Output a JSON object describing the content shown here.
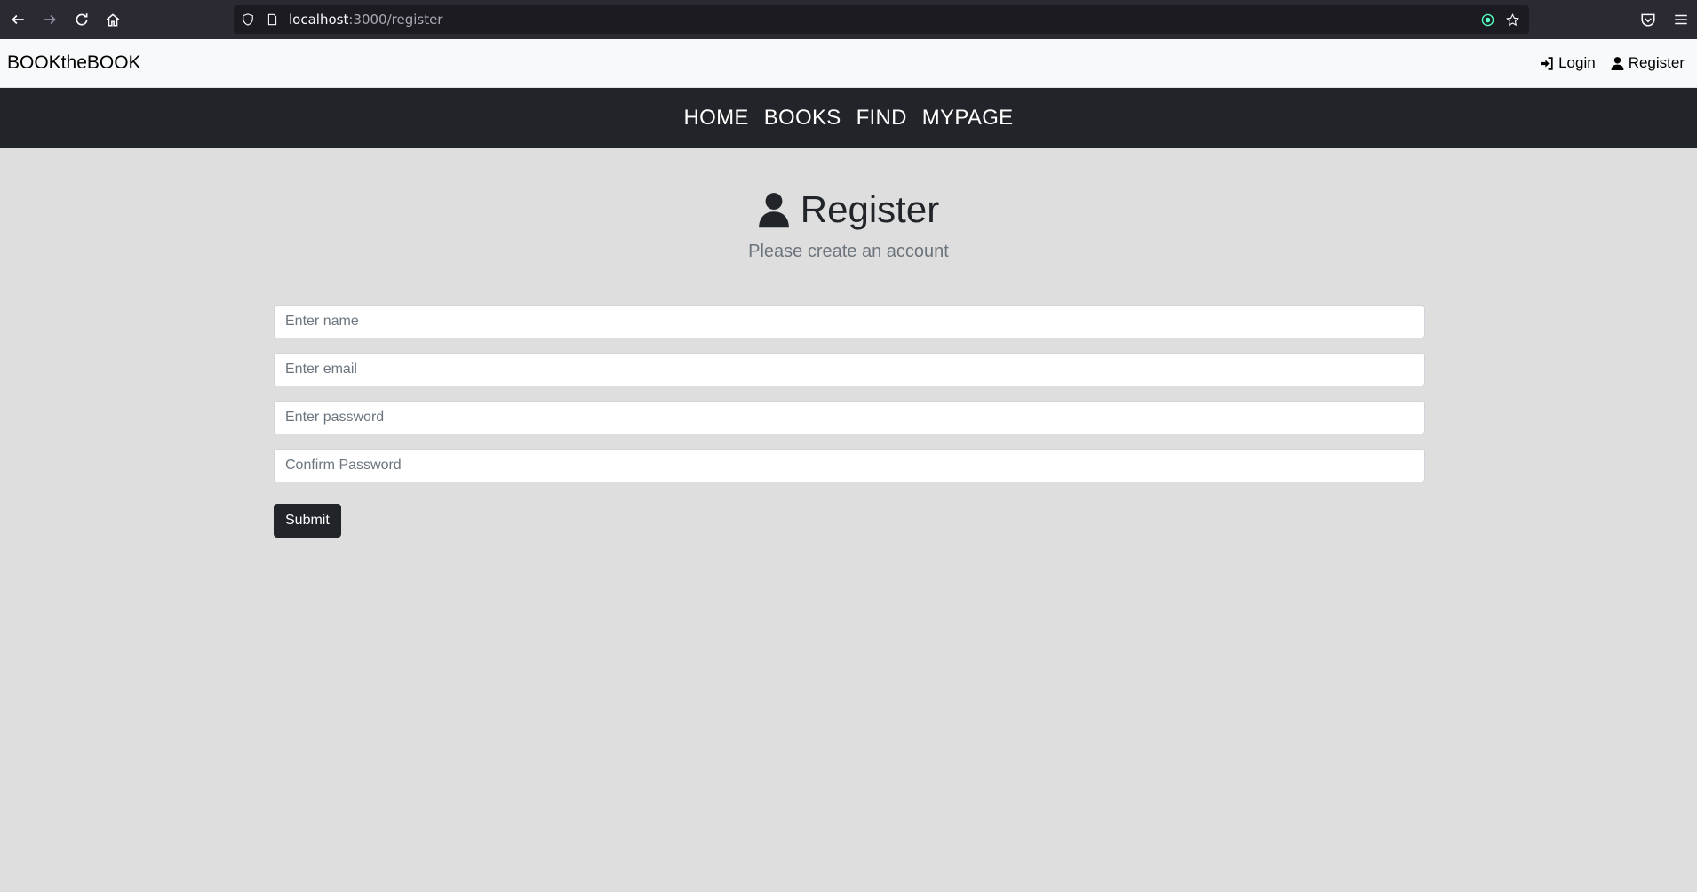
{
  "browser": {
    "url_host": "localhost",
    "url_path": ":3000/register"
  },
  "header": {
    "brand": "BOOKtheBOOK",
    "login_label": "Login",
    "register_label": "Register"
  },
  "nav": {
    "items": [
      "HOME",
      "BOOKS",
      "FIND",
      "MYPAGE"
    ]
  },
  "page": {
    "title": "Register",
    "subtitle": "Please create an account"
  },
  "form": {
    "name_placeholder": "Enter name",
    "email_placeholder": "Enter email",
    "password_placeholder": "Enter password",
    "confirm_placeholder": "Confirm Password",
    "submit_label": "Submit"
  },
  "colors": {
    "nav_bg": "#212529",
    "page_bg": "#dedede",
    "browser_bg": "#2b2a33"
  }
}
